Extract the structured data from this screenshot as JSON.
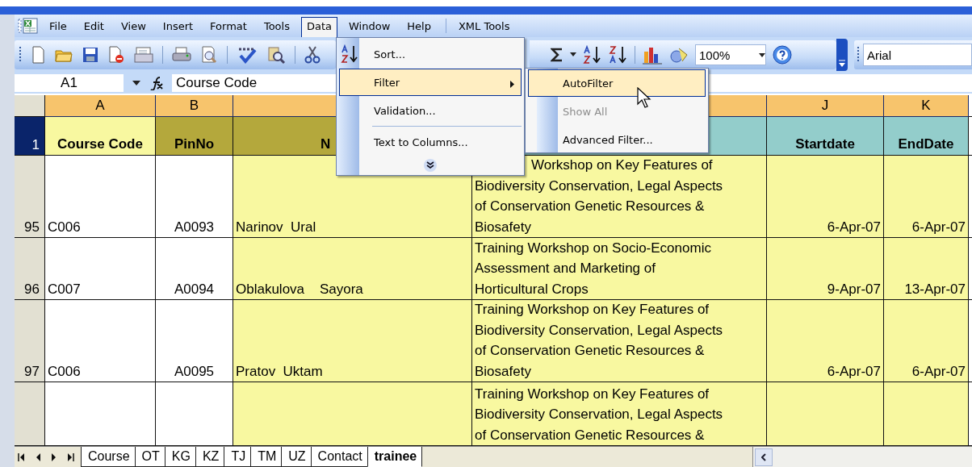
{
  "menu_bar": {
    "items": [
      {
        "label": "File",
        "selected": false
      },
      {
        "label": "Edit",
        "selected": false
      },
      {
        "label": "View",
        "selected": false
      },
      {
        "label": "Insert",
        "selected": false
      },
      {
        "label": "Format",
        "selected": false
      },
      {
        "label": "Tools",
        "selected": false
      },
      {
        "label": "Data",
        "selected": true
      },
      {
        "label": "Window",
        "selected": false
      },
      {
        "label": "Help",
        "selected": false
      },
      {
        "label": "XML Tools",
        "selected": false
      }
    ]
  },
  "toolbar": {
    "zoom": "100%",
    "font": "Arial"
  },
  "formula_bar": {
    "cell": "A1",
    "content": "Course Code"
  },
  "columns": [
    {
      "label": "A"
    },
    {
      "label": "B"
    },
    {},
    {},
    {
      "label": "J"
    },
    {
      "label": "K"
    }
  ],
  "header_row": {
    "number": "1",
    "selected": true,
    "cells": [
      {
        "text": "Course Code"
      },
      {
        "text": "PinNo"
      },
      {
        "text": "N"
      },
      {},
      {
        "text": "Startdate"
      },
      {
        "text": "EndDate"
      }
    ]
  },
  "rows": [
    {
      "number": "95",
      "code": "C006",
      "pin": "A0093",
      "name": "Narinov  Ural",
      "title": "Workshop on Key Features of\nBiodiversity Conservation, Legal Aspects\nof Conservation Genetic Resources &\nBiosafety",
      "start": "6-Apr-07",
      "end": "6-Apr-07"
    },
    {
      "number": "96",
      "code": "C007",
      "pin": "A0094",
      "name": "Oblakulova    Sayora",
      "title": "Training Workshop on Socio-Economic\nAssessment and Marketing of\nHorticultural Crops",
      "start": "9-Apr-07",
      "end": "13-Apr-07"
    },
    {
      "number": "97",
      "code": "C006",
      "pin": "A0095",
      "name": "Pratov  Uktam",
      "title": "Training Workshop on Key Features of\nBiodiversity Conservation, Legal Aspects\nof Conservation Genetic Resources &\nBiosafety",
      "start": "6-Apr-07",
      "end": "6-Apr-07"
    },
    {
      "title": "Training Workshop on Key Features of\nBiodiversity Conservation, Legal Aspects\nof Conservation Genetic Resources &"
    }
  ],
  "data_menu": {
    "items": [
      {
        "kind": "item",
        "label": "Sort...",
        "selected": false
      },
      {
        "kind": "submenu",
        "label": "Filter",
        "selected": true
      },
      {
        "kind": "item",
        "label": "Validation...",
        "selected": false
      },
      {
        "kind": "separator"
      },
      {
        "kind": "item",
        "label": "Text to Columns...",
        "selected": false
      },
      {
        "kind": "expand"
      }
    ]
  },
  "filter_submenu": {
    "items": [
      {
        "label": "AutoFilter",
        "selected": true,
        "disabled": false
      },
      {
        "label": "Show All",
        "selected": false,
        "disabled": true
      },
      {
        "label": "Advanced Filter...",
        "selected": false,
        "disabled": false
      }
    ]
  },
  "sheet_tabs": [
    {
      "label": "Course",
      "selected": false
    },
    {
      "label": "OT",
      "selected": false
    },
    {
      "label": "KG",
      "selected": false
    },
    {
      "label": "KZ",
      "selected": false
    },
    {
      "label": "TJ",
      "selected": false
    },
    {
      "label": "TM",
      "selected": false
    },
    {
      "label": "UZ",
      "selected": false
    },
    {
      "label": "Contact",
      "selected": false
    },
    {
      "label": "trainee",
      "selected": true
    }
  ]
}
